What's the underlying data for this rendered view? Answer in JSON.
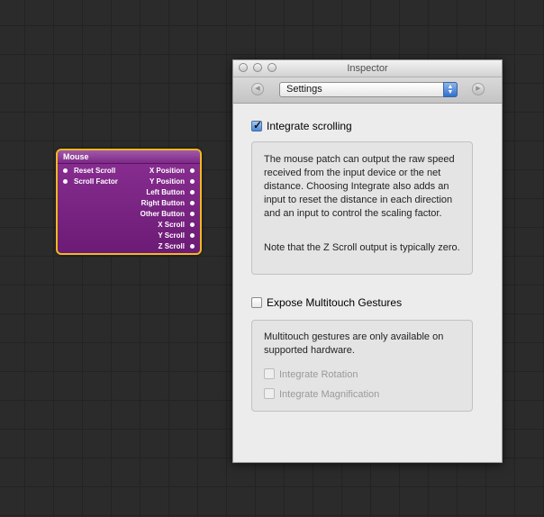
{
  "patch": {
    "title": "Mouse",
    "inputs": [
      "Reset Scroll",
      "Scroll Factor"
    ],
    "outputs": [
      "X Position",
      "Y Position",
      "Left Button",
      "Right Button",
      "Other Button",
      "X Scroll",
      "Y Scroll",
      "Z Scroll"
    ]
  },
  "inspector": {
    "window_title": "Inspector",
    "view_select": "Settings",
    "integrate_scrolling": {
      "label": "Integrate scrolling",
      "checked": true
    },
    "scroll_description": "The mouse patch can output the raw speed received from the input device or the net distance. Choosing Integrate also adds an input to reset the distance in each direction and an input to control the scaling factor.",
    "scroll_note": "Note that the Z Scroll output is typically zero.",
    "multitouch": {
      "label": "Expose Multitouch Gestures",
      "checked": false
    },
    "multitouch_description": "Multitouch gestures are only available on supported hardware.",
    "integrate_rotation": {
      "label": "Integrate Rotation",
      "checked": false,
      "enabled": false
    },
    "integrate_magnification": {
      "label": "Integrate Magnification",
      "checked": false,
      "enabled": false
    }
  },
  "colors": {
    "patch_border": "#f2b81f",
    "patch_fill": "#7a2385",
    "canvas_bg": "#2b2b2b"
  }
}
